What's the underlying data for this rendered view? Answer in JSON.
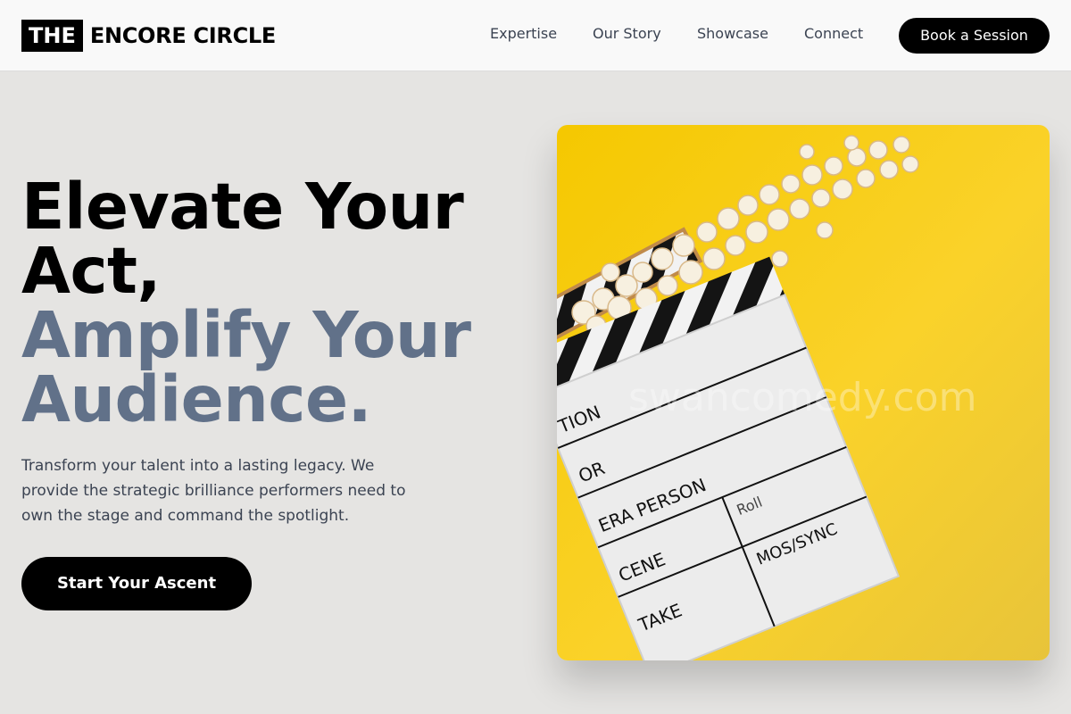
{
  "header": {
    "logo_mark": "THE",
    "logo_text": "ENCORE CIRCLE",
    "nav": [
      "Expertise",
      "Our Story",
      "Showcase",
      "Connect"
    ],
    "cta_label": "Book a Session"
  },
  "hero": {
    "headline_line1": "Elevate Your",
    "headline_line2": "Act,",
    "headline_line3": "Amplify Your",
    "headline_line4": "Audience.",
    "subtext": "Transform your talent into a lasting legacy. We provide the strategic brilliance performers need to own the stage and command the spotlight.",
    "cta_label": "Start Your Ascent"
  },
  "image": {
    "clapper_labels": [
      "TION",
      "OR",
      "ERA PERSON",
      "Roll",
      "CENE",
      "MOS/SYNC",
      "TAKE"
    ],
    "watermark": "swancomedy.com"
  },
  "colors": {
    "page_bg": "#e5e4e2",
    "header_bg": "#f9f9f9",
    "accent_text": "#617189",
    "image_bg": "#f7cf1d"
  }
}
